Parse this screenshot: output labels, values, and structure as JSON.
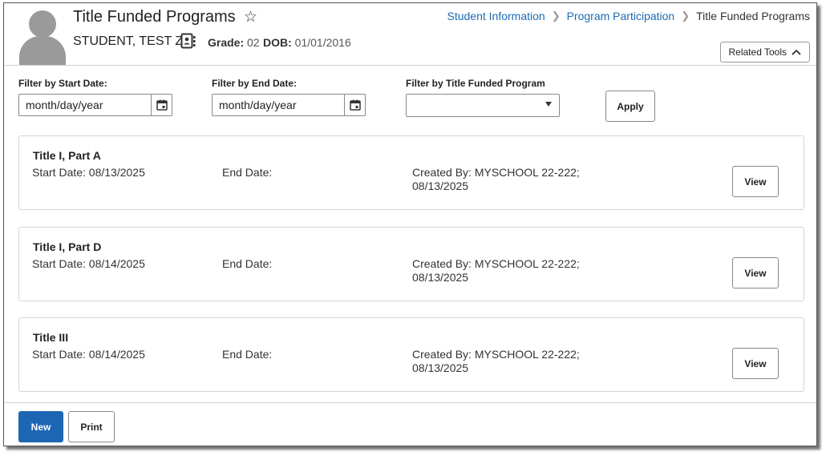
{
  "header": {
    "page_title": "Title Funded Programs",
    "student_name": "STUDENT, TEST Z",
    "grade_label": "Grade:",
    "grade_value": "02",
    "dob_label": "DOB:",
    "dob_value": "01/01/2016",
    "related_tools_label": "Related Tools"
  },
  "breadcrumb": {
    "items": [
      "Student Information",
      "Program Participation",
      "Title Funded Programs"
    ]
  },
  "filters": {
    "start_date_label": "Filter by Start Date:",
    "start_date_placeholder": "month/day/year",
    "end_date_label": "Filter by End Date:",
    "end_date_placeholder": "month/day/year",
    "program_label": "Filter by Title Funded Program",
    "program_value": "",
    "apply_label": "Apply"
  },
  "programs": [
    {
      "title": "Title I, Part A",
      "start": "Start Date: 08/13/2025",
      "end": "End Date:",
      "created_line1": "Created By: MYSCHOOL 22-222;",
      "created_line2": "08/13/2025",
      "view_label": "View"
    },
    {
      "title": "Title I, Part D",
      "start": "Start Date: 08/14/2025",
      "end": "End Date:",
      "created_line1": "Created By: MYSCHOOL 22-222;",
      "created_line2": "08/13/2025",
      "view_label": "View"
    },
    {
      "title": "Title III",
      "start": "Start Date: 08/14/2025",
      "end": "End Date:",
      "created_line1": "Created By: MYSCHOOL 22-222;",
      "created_line2": "08/13/2025",
      "view_label": "View"
    }
  ],
  "footer": {
    "new_label": "New",
    "print_label": "Print"
  },
  "colors": {
    "accent": "#1d66b3",
    "link": "#1c6bb5",
    "avatar": "#9a9a9a"
  },
  "icons": [
    "person-avatar-icon",
    "star-outline-icon",
    "contact-card-icon",
    "chevron-right-icon",
    "chevron-up-icon",
    "calendar-icon",
    "caret-down-icon"
  ]
}
